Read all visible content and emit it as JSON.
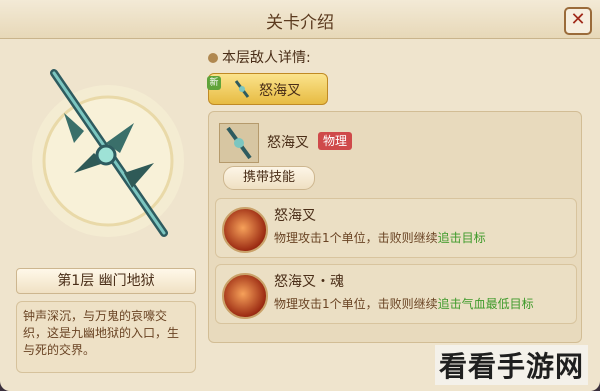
{
  "window": {
    "title": "关卡介绍",
    "close_glyph": "✕"
  },
  "floor": {
    "label": "第1层   幽门地狱",
    "description": "钟声深沉，与万鬼的哀嚎交织，这是九幽地狱的入口，生与死的交界。"
  },
  "enemy_section": {
    "heading": "本层敌人详情:",
    "tab_tag": "新",
    "tab_name": "怒海叉",
    "enemy_name": "怒海叉",
    "damage_type": "物理",
    "skills_heading": "携带技能",
    "skills": [
      {
        "name": "怒海叉",
        "desc_plain": "物理攻击1个单位，击败则继续",
        "desc_highlight": "追击目标"
      },
      {
        "name": "怒海叉・魂",
        "desc_plain": "物理攻击1个单位，击败则继续",
        "desc_highlight": "追击气血最低目标"
      }
    ]
  },
  "watermark": "看看手游网",
  "colors": {
    "accent": "#e7bb42",
    "highlight": "#3e9a2a",
    "badge": "#cf4a4a"
  }
}
